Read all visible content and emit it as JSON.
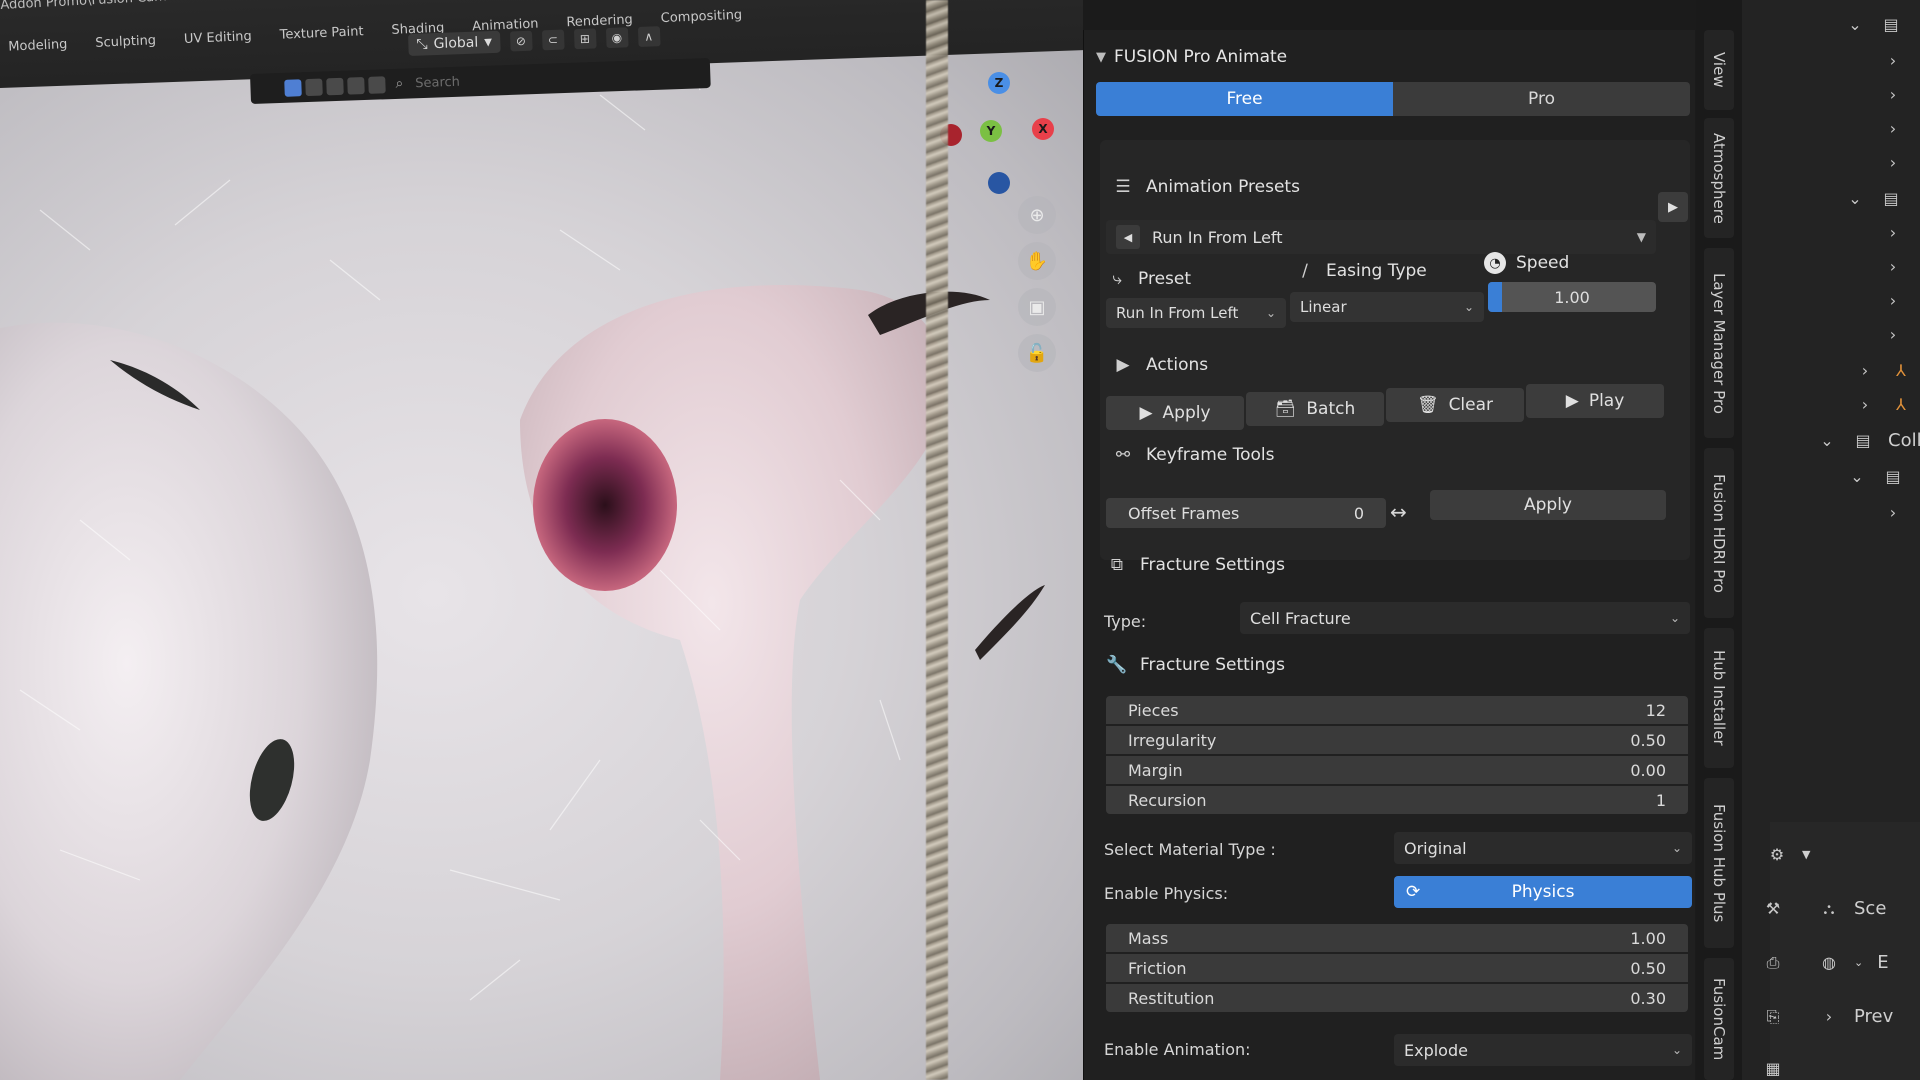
{
  "viewport": {
    "path_text": "Addon Promo\\Fusion Cam Pro\\Screenshot",
    "workspace_tabs": [
      "Modeling",
      "Sculpting",
      "UV Editing",
      "Texture Paint",
      "Shading",
      "Animation",
      "Rendering",
      "Compositing"
    ],
    "transform_orientation": "Global",
    "search_placeholder": "Search",
    "gizmo": {
      "z": "Z",
      "y": "Y",
      "x": "X"
    }
  },
  "panel": {
    "title": "FUSION Pro Animate",
    "tabs": {
      "free": "Free",
      "pro": "Pro"
    },
    "animation_presets": {
      "title": "Animation Presets",
      "current": "Run In From Left",
      "preset_label": "Preset",
      "easing_label": "Easing Type",
      "speed_label": "Speed",
      "preset_value": "Run In From Left",
      "easing_value": "Linear",
      "speed_value": "1.00"
    },
    "actions": {
      "title": "Actions",
      "apply": "Apply",
      "batch": "Batch",
      "clear": "Clear",
      "play": "Play"
    },
    "keyframe_tools": {
      "title": "Keyframe Tools",
      "offset_label": "Offset Frames",
      "offset_value": "0",
      "apply": "Apply"
    },
    "fracture": {
      "title": "Fracture Settings",
      "type_label": "Type:",
      "type_value": "Cell Fracture",
      "sub_title": "Fracture Settings",
      "rows": [
        {
          "label": "Pieces",
          "value": "12"
        },
        {
          "label": "Irregularity",
          "value": "0.50"
        },
        {
          "label": "Margin",
          "value": "0.00"
        },
        {
          "label": "Recursion",
          "value": "1"
        }
      ],
      "material_label": "Select Material Type :",
      "material_value": "Original",
      "physics_label": "Enable Physics:",
      "physics_button": "Physics",
      "physics_rows": [
        {
          "label": "Mass",
          "value": "1.00"
        },
        {
          "label": "Friction",
          "value": "0.50"
        },
        {
          "label": "Restitution",
          "value": "0.30"
        }
      ],
      "animation_label": "Enable Animation:",
      "animation_value": "Explode"
    }
  },
  "side_tabs": [
    "View",
    "Atmosphere",
    "Layer Manager Pro",
    "Fusion HDRI Pro",
    "Hub Installer",
    "Fusion Hub Plus",
    "FusionCam"
  ],
  "outliner": {
    "collection_label": "Coll",
    "scene_label": "Sce",
    "preview_label": "Prev",
    "e_label": "E"
  },
  "colors": {
    "accent": "#3a7fd6",
    "panel_bg": "#202020",
    "box_bg": "#262626"
  }
}
